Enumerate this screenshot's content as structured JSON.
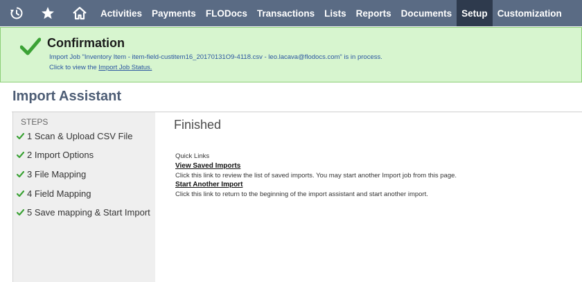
{
  "nav": {
    "icons": [
      "recent-icon",
      "star-icon",
      "home-icon"
    ],
    "items": [
      "Activities",
      "Payments",
      "FLODocs",
      "Transactions",
      "Lists",
      "Reports",
      "Documents",
      "Setup",
      "Customization"
    ],
    "active": "Setup",
    "background": "#5a6b84",
    "active_background": "#2e3a4d"
  },
  "confirmation": {
    "title": "Confirmation",
    "message": "Import Job \"Inventory Item - item-field-custitem16_20170131O9-4118.csv - leo.lacava@flodocs.com\" is in process.",
    "link_prefix": "Click to view the ",
    "link_text": "Import Job Status.",
    "background": "#d7f5cf",
    "check_color": "#3ba235"
  },
  "page": {
    "title": "Import Assistant"
  },
  "steps": {
    "header": "STEPS",
    "items": [
      "1 Scan & Upload CSV File",
      "2 Import Options",
      "3 File Mapping",
      "4 Field Mapping",
      "5 Save mapping & Start Import"
    ]
  },
  "main": {
    "heading": "Finished",
    "quick_links_label": "Quick Links",
    "links": [
      {
        "label": "View Saved Imports",
        "description": "Click this link to review the list of saved imports. You may start another Import job from this page."
      },
      {
        "label": "Start Another Import",
        "description": "Click this link to return to the beginning of the import assistant and start another import."
      }
    ]
  }
}
